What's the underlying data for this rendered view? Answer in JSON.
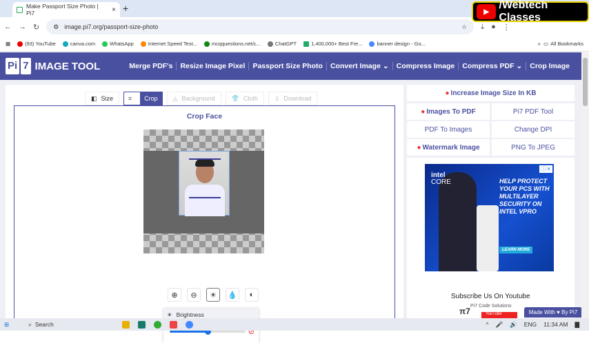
{
  "browser": {
    "tab_title": "Make Passport Size Photo | Pi7",
    "url": "image.pi7.org/passport-size-photo",
    "bookmarks": [
      "(93) YouTube",
      "canva.com",
      "WhatsApp",
      "Internet Speed Test...",
      "mcqquestions.net/c...",
      "ChatGPT",
      "1,400,000+ Best Fre...",
      "banner design - Go..."
    ],
    "all_bookmarks": "All Bookmarks"
  },
  "overlay": {
    "channel": "/Webtech Classes"
  },
  "site": {
    "logo_a": "Pi",
    "logo_b": "7",
    "logo_text": "IMAGE TOOL",
    "menu": [
      "Merge PDF's",
      "Resize Image Pixel",
      "Passport Size Photo",
      "Convert Image ⌄",
      "Compress Image",
      "Compress PDF ⌄",
      "Crop Image"
    ]
  },
  "tools": [
    "Size",
    "Crop",
    "Background",
    "Cloth",
    "Download"
  ],
  "editor": {
    "title": "Crop Face",
    "brightness_label": "Brightness",
    "brightness_value": 0.5
  },
  "sidebar": {
    "links": [
      "Increase Image Size In KB",
      "Images To PDF",
      "Pi7 PDF Tool",
      "PDF To Images",
      "Change DPI",
      "Watermark Image",
      "PNG To JPEG"
    ],
    "ad": {
      "brand": "intel",
      "sub": "CORE",
      "headline": "HELP PROTECT YOUR PCS WITH MULTILAYER SECURITY ON INTEL VPRO",
      "cta": "LEARN MORE"
    },
    "subscribe": "Subscribe Us On Youtube",
    "channel": "Pi7 Code Solutions",
    "yt": "YouTube"
  },
  "made_with": "Made With ♥ By Pi7",
  "taskbar": {
    "search": "Search",
    "lang": "ENG",
    "time": "11:34 AM"
  }
}
